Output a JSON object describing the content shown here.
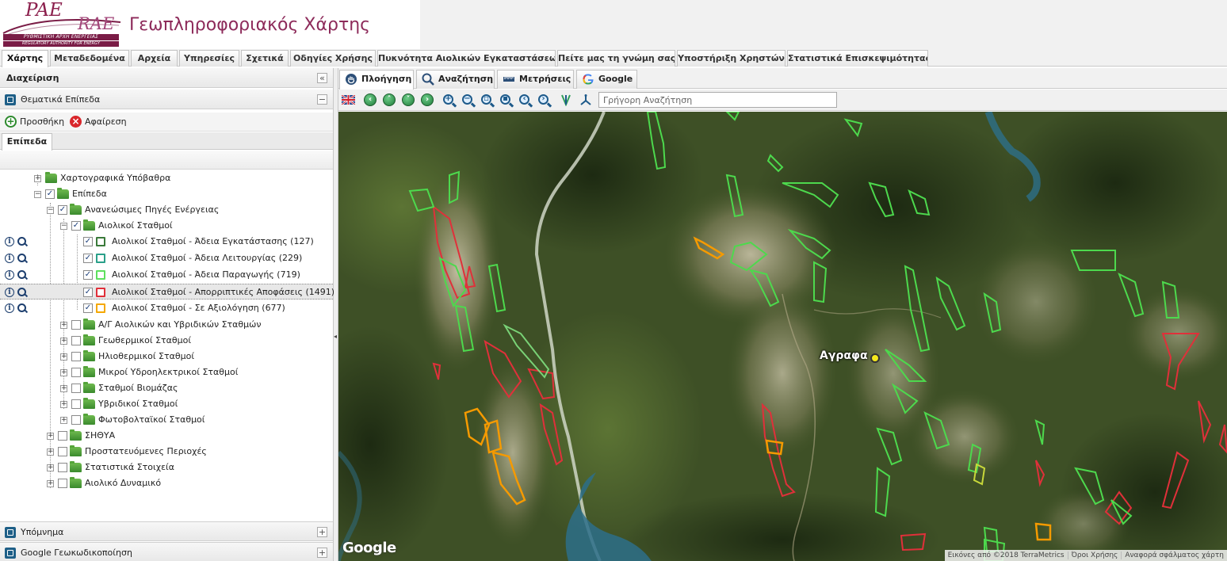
{
  "header": {
    "logo_pae": "PAE",
    "logo_rae": "RAE",
    "logo_greek": "ΡΥΘΜΙΣΤΙΚΗ ΑΡΧΗ ΕΝΕΡΓΕΙΑΣ",
    "logo_english": "REGULATORY AUTHORITY FOR ENERGY",
    "title": "Γεωπληροφοριακός Χάρτης"
  },
  "top_tabs": [
    "Χάρτης",
    "Μεταδεδομένα",
    "Αρχεία",
    "Υπηρεσίες",
    "Σχετικά",
    "Οδηγίες Χρήσης",
    "Πυκνότητα Αιολικών Εγκαταστάσεων",
    "Πείτε μας τη γνώμη σας",
    "Υποστήριξη Χρηστών",
    "Στατιστικά Επισκεψιμότητας"
  ],
  "left_panel": {
    "title": "Διαχείριση",
    "collapse_icon": "«",
    "thematic_title": "Θεματικά Επίπεδα",
    "add_label": "Προσθήκη",
    "remove_label": "Αφαίρεση",
    "layers_tab": "Επίπεδα",
    "legend_title": "Υπόμνημα",
    "geocoding_title": "Google Γεωκωδικοποίηση"
  },
  "tree": [
    {
      "label": "Χαρτογραφικά Υπόβαθρα",
      "checked": false,
      "folder": true
    },
    {
      "label": "Επίπεδα",
      "checked": true,
      "folder": true
    },
    {
      "label": "Ανανεώσιμες Πηγές Ενέργειας",
      "checked": true,
      "folder": true
    },
    {
      "label": "Αιολικοί Σταθμοί",
      "checked": true,
      "folder": true
    },
    {
      "label": "Αιολικοί Σταθμοί - Άδεια Εγκατάστασης (127)",
      "checked": true,
      "color": "#3a7a3a"
    },
    {
      "label": "Αιολικοί Σταθμοί - Άδεια Λειτουργίας (229)",
      "checked": true,
      "color": "#2aa08a"
    },
    {
      "label": "Αιολικοί Σταθμοί - Άδεια Παραγωγής (719)",
      "checked": true,
      "color": "#5ee05e"
    },
    {
      "label": "Αιολικοί Σταθμοί - Απορριπτικές Αποφάσεις (1491)",
      "checked": true,
      "color": "#e0303a"
    },
    {
      "label": "Αιολικοί Σταθμοί - Σε Αξιολόγηση (677)",
      "checked": true,
      "color": "#f5a800"
    },
    {
      "label": "Α/Γ Αιολικών και Υβριδικών Σταθμών",
      "checked": false,
      "folder": true
    },
    {
      "label": "Γεωθερμικοί Σταθμοί",
      "checked": false,
      "folder": true
    },
    {
      "label": "Ηλιοθερμικοί Σταθμοί",
      "checked": false,
      "folder": true
    },
    {
      "label": "Μικροί Υδροηλεκτρικοί Σταθμοί",
      "checked": false,
      "folder": true
    },
    {
      "label": "Σταθμοί Βιομάζας",
      "checked": false,
      "folder": true
    },
    {
      "label": "Υβριδικοί Σταθμοί",
      "checked": false,
      "folder": true
    },
    {
      "label": "Φωτοβολταϊκοί Σταθμοί",
      "checked": false,
      "folder": true
    },
    {
      "label": "ΣΗΘΥΑ",
      "checked": false,
      "folder": true
    },
    {
      "label": "Προστατευόμενες Περιοχές",
      "checked": false,
      "folder": true
    },
    {
      "label": "Στατιστικά Στοιχεία",
      "checked": false,
      "folder": true
    },
    {
      "label": "Αιολικό Δυναμικό",
      "checked": false,
      "folder": true
    }
  ],
  "map_tabs": [
    {
      "label": "Πλοήγηση",
      "icon": "hand-icon"
    },
    {
      "label": "Αναζήτηση",
      "icon": "magnifier-icon"
    },
    {
      "label": "Μετρήσεις",
      "icon": "ruler-icon"
    },
    {
      "label": "Google",
      "icon": "google-icon"
    }
  ],
  "toolbar": {
    "search_placeholder": "Γρήγορη Αναζήτηση"
  },
  "map": {
    "place_label": "Αγραφα",
    "provider_logo": "Google",
    "attribution": [
      "Εικόνες από ©2018 TerraMetrics",
      "Όροι Χρήσης",
      "Αναφορά σφάλματος χάρτη"
    ]
  },
  "colors": {
    "brand": "#8d2a5a",
    "rejected": "#e0303a",
    "production": "#5ee05e",
    "evaluation": "#f5a800"
  }
}
